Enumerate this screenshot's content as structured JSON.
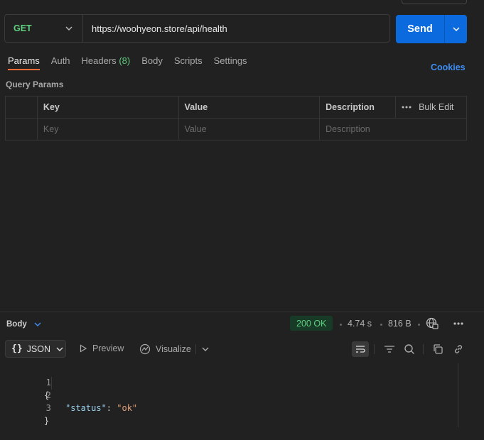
{
  "request": {
    "method": "GET",
    "url": "https://woohyeon.store/api/health",
    "send_label": "Send"
  },
  "tabs": [
    {
      "label": "Params",
      "active": true
    },
    {
      "label": "Auth"
    },
    {
      "label": "Headers",
      "count": "(8)"
    },
    {
      "label": "Body"
    },
    {
      "label": "Scripts"
    },
    {
      "label": "Settings"
    }
  ],
  "cookies_label": "Cookies",
  "query_params": {
    "title": "Query Params",
    "columns": [
      "Key",
      "Value",
      "Description"
    ],
    "bulk_edit": "Bulk Edit",
    "placeholders": {
      "key": "Key",
      "value": "Value",
      "description": "Description"
    }
  },
  "response": {
    "section_label": "Body",
    "status": "200 OK",
    "time": "4.74 s",
    "size": "816 B",
    "format": "JSON",
    "preview_label": "Preview",
    "visualize_label": "Visualize",
    "lines": [
      {
        "num": "1",
        "text": "{"
      },
      {
        "num": "2",
        "key": "\"status\"",
        "sep": ": ",
        "value": "\"ok\""
      },
      {
        "num": "3",
        "text": "}"
      }
    ]
  },
  "colors": {
    "accent": "#ff6c37",
    "send": "#0c6adf",
    "method_get": "#5fcf80",
    "status_ok": "#5fcf80",
    "link": "#3d8ef5"
  }
}
